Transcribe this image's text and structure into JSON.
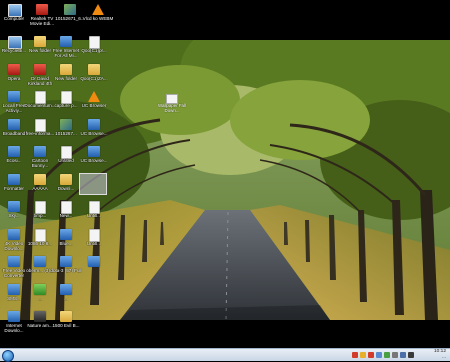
{
  "top_icons": [
    {
      "label": "Computer",
      "icon": "computer-icon"
    },
    {
      "label": "Realtek TV Movie Edi...",
      "icon": "red-app-icon"
    },
    {
      "label": "10152671_6...",
      "icon": "image-file-icon"
    },
    {
      "label": "Vlcd ko WEBM",
      "icon": "vlc-icon"
    }
  ],
  "col1": [
    {
      "label": "RecycleBi...",
      "icon": "recycle-bin-icon"
    },
    {
      "label": "Opera",
      "icon": "opera-icon"
    },
    {
      "label": "Locall Free Activiy...",
      "icon": "app-icon"
    },
    {
      "label": "Broadband",
      "icon": "network-icon"
    },
    {
      "label": "Ecosi...",
      "icon": "app-icon"
    },
    {
      "label": "Formatter",
      "icon": "app-icon"
    },
    {
      "label": "Sky...",
      "icon": "app-icon"
    },
    {
      "label": "4K Video Downlo...",
      "icon": "app-icon"
    },
    {
      "label": "Free Video Converter",
      "icon": "app-icon"
    },
    {
      "label": "SMS...",
      "icon": "app-icon"
    },
    {
      "label": "Internet Downlo...",
      "icon": "app-icon"
    }
  ],
  "col2": [
    {
      "label": "New folder",
      "icon": "folder-icon"
    },
    {
      "label": "Dr David Kirkland 4th",
      "icon": "red-app-icon"
    },
    {
      "label": "Documentum...",
      "icon": "document-icon"
    },
    {
      "label": "free-informa...",
      "icon": "document-icon"
    },
    {
      "label": "Cartoon Bunny...",
      "icon": "app-icon"
    },
    {
      "label": "AAAAA",
      "icon": "folder-icon"
    },
    {
      "label": "bmp...",
      "icon": "document-icon"
    },
    {
      "label": "1086 10 6...",
      "icon": "document-icon"
    },
    {
      "label": "oberm... (3)...",
      "icon": "app-icon"
    },
    {
      "label": "...",
      "icon": "green-app-icon"
    },
    {
      "label": "Nature am...",
      "icon": "dark-app-icon"
    }
  ],
  "col3": [
    {
      "label": "Free Internet For All Mi...",
      "icon": "app-icon"
    },
    {
      "label": "New folder",
      "icon": "folder-icon"
    },
    {
      "label": "capture p...",
      "icon": "document-icon"
    },
    {
      "label": "1015267...",
      "icon": "image-file-icon"
    },
    {
      "label": "Untitled",
      "icon": "document-icon"
    },
    {
      "label": "Downl...",
      "icon": "folder-icon"
    },
    {
      "label": "New...",
      "icon": "document-icon"
    },
    {
      "label": "Blue...",
      "icon": "app-icon"
    },
    {
      "label": "dota-3 (57) Full",
      "icon": "app-icon"
    },
    {
      "label": "...",
      "icon": "app-icon"
    },
    {
      "label": "1500 Evil B...",
      "icon": "folder-icon"
    }
  ],
  "col4": [
    {
      "label": "Qoo(C1)pr...",
      "icon": "document-icon"
    },
    {
      "label": "Qoo(C1)ZA...",
      "icon": "folder-icon"
    },
    {
      "label": "UC Browser",
      "icon": "vlc-icon"
    },
    {
      "label": "UC Browse...",
      "icon": "app-icon"
    },
    {
      "label": "UC Browse...",
      "icon": "app-icon"
    },
    {
      "label": "",
      "icon": "selected-icon"
    },
    {
      "label": "Untitl...",
      "icon": "document-icon"
    },
    {
      "label": "Untitl...",
      "icon": "document-icon"
    },
    {
      "label": "",
      "icon": "app-icon"
    }
  ],
  "wallpaper_file": {
    "label": "Wallpaper Fall Down...",
    "icon": "document-icon"
  },
  "clock": {
    "time": "10:12",
    "date": "..."
  }
}
